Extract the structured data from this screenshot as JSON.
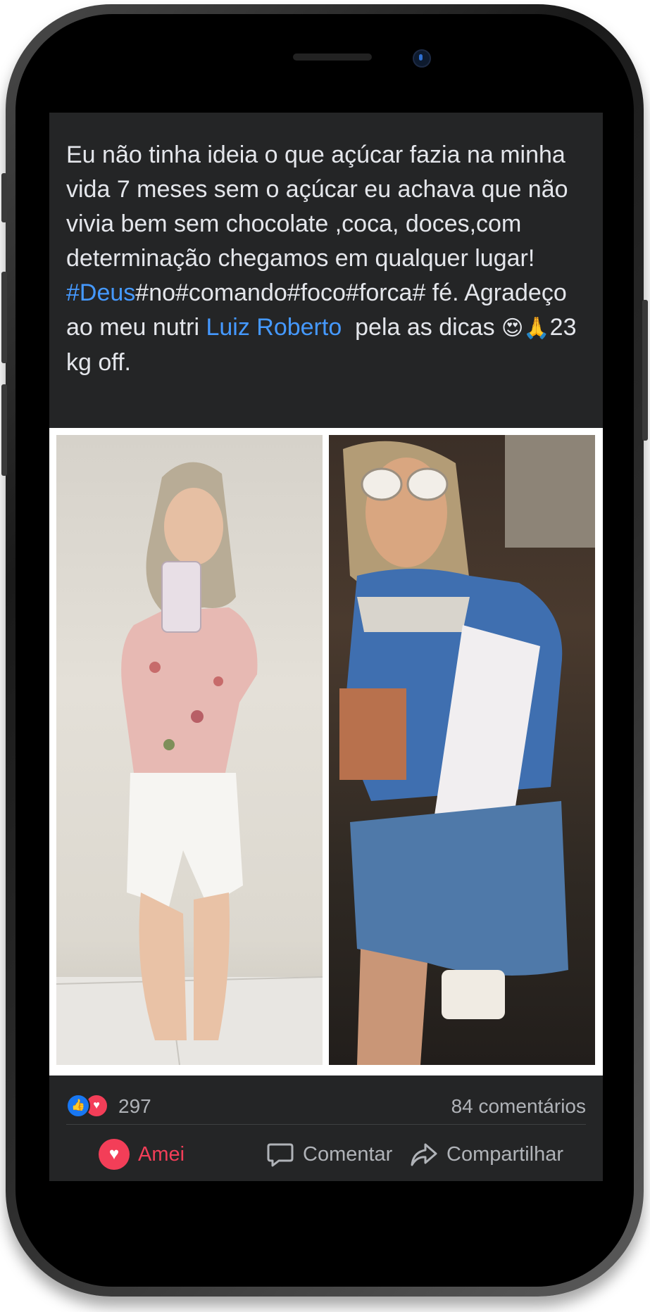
{
  "post": {
    "text_line1": "Eu não tinha ideia o que açúcar fazia na minha",
    "text_line2": "vida 7 meses sem o açúcar eu achava que não",
    "text_line3": "vivia bem sem chocolate ,coca, doces,com",
    "text_line4": "determinação chegamos em qualquer lugar!",
    "hashtag": "#Deus",
    "text_after_hashtag": "#no#comando#foco#forca# fé. Agradeço",
    "text_before_mention": "ao meu nutri ",
    "mention": "Luiz Roberto",
    "text_after_mention": "  pela as dicas ",
    "emojis": "😍🙏",
    "text_end": "23",
    "text_last_line": "kg off."
  },
  "stats": {
    "reaction_icons": [
      "like-icon",
      "love-icon"
    ],
    "reactions_count": "297",
    "comments_count": "84 comentários"
  },
  "actions": {
    "love_label": "Amei",
    "comment_label": "Comentar",
    "share_label": "Compartilhar"
  },
  "colors": {
    "background": "#242526",
    "text": "#e4e6eb",
    "link": "#4599ff",
    "love": "#f33e58",
    "like": "#1877f2",
    "muted": "#b0b3b8"
  }
}
